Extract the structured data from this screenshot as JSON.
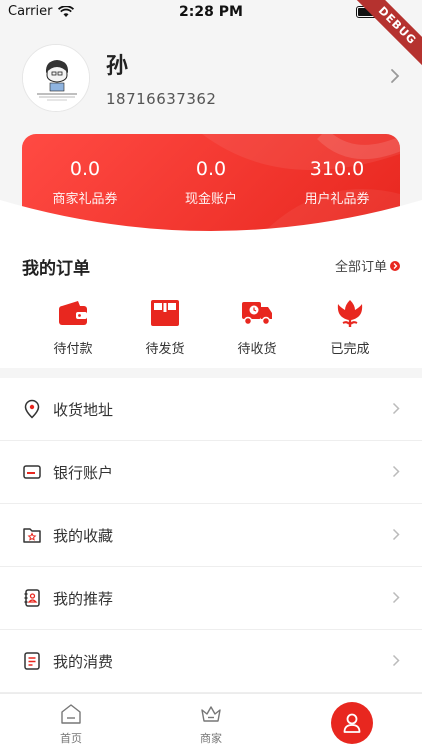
{
  "status_bar": {
    "carrier": "Carrier",
    "time": "2:28 PM"
  },
  "debug_banner": "DEBUG",
  "profile": {
    "name": "孙",
    "phone": "18716637362",
    "avatar_icon": "avatar-sketch-image"
  },
  "stats": [
    {
      "value": "0.0",
      "label": "商家礼品券"
    },
    {
      "value": "0.0",
      "label": "现金账户"
    },
    {
      "value": "310.0",
      "label": "用户礼品券"
    }
  ],
  "orders": {
    "title": "我的订单",
    "view_all": "全部订单",
    "items": [
      {
        "label": "待付款",
        "icon": "wallet-icon"
      },
      {
        "label": "待发货",
        "icon": "box-icon"
      },
      {
        "label": "待收货",
        "icon": "truck-icon"
      },
      {
        "label": "已完成",
        "icon": "flower-icon"
      }
    ]
  },
  "menu": [
    {
      "label": "收货地址",
      "icon": "location-pin-icon"
    },
    {
      "label": "银行账户",
      "icon": "card-icon"
    },
    {
      "label": "我的收藏",
      "icon": "star-folder-icon"
    },
    {
      "label": "我的推荐",
      "icon": "contact-book-icon"
    },
    {
      "label": "我的消费",
      "icon": "receipt-icon"
    }
  ],
  "tab_bar": {
    "items": [
      {
        "label": "首页",
        "icon": "home-icon"
      },
      {
        "label": "商家",
        "icon": "crown-icon"
      }
    ],
    "active_icon": "user-icon"
  },
  "colors": {
    "accent": "#e8271f",
    "background": "#f5f5f5"
  }
}
